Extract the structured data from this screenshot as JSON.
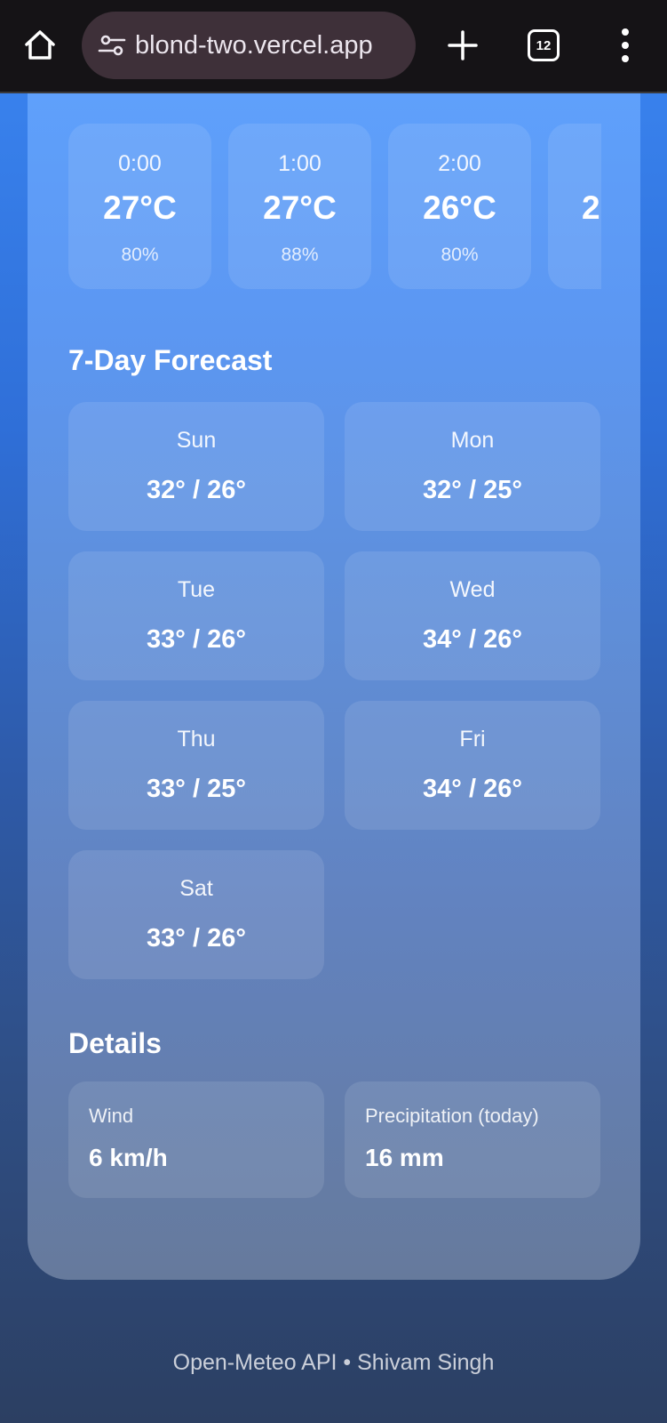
{
  "browser": {
    "url": "blond-two.vercel.app",
    "tab_count": "12",
    "icons": [
      "home-icon",
      "site-settings-icon",
      "plus-icon",
      "tabs-icon",
      "more-vert-icon"
    ]
  },
  "hourly": [
    {
      "time": "0:00",
      "temp": "27°C",
      "humidity": "80%"
    },
    {
      "time": "1:00",
      "temp": "27°C",
      "humidity": "88%"
    },
    {
      "time": "2:00",
      "temp": "26°C",
      "humidity": "80%"
    },
    {
      "time": "",
      "temp": "2",
      "humidity": ""
    }
  ],
  "forecast": {
    "title": "7-Day Forecast",
    "days": [
      {
        "day": "Sun",
        "temps": "32° / 26°"
      },
      {
        "day": "Mon",
        "temps": "32° / 25°"
      },
      {
        "day": "Tue",
        "temps": "33° / 26°"
      },
      {
        "day": "Wed",
        "temps": "34° / 26°"
      },
      {
        "day": "Thu",
        "temps": "33° / 25°"
      },
      {
        "day": "Fri",
        "temps": "34° / 26°"
      },
      {
        "day": "Sat",
        "temps": "33° / 26°"
      }
    ]
  },
  "details": {
    "title": "Details",
    "wind_label": "Wind",
    "wind_value": "6 km/h",
    "precip_label": "Precipitation (today)",
    "precip_value": "16 mm"
  },
  "footer": {
    "text": "Open-Meteo API • Shivam Singh"
  },
  "colors": {
    "browser_bar": "#151316",
    "url_pill": "#3e3039",
    "card_top": "#5fa0fb",
    "card_bottom": "#667a9c"
  }
}
